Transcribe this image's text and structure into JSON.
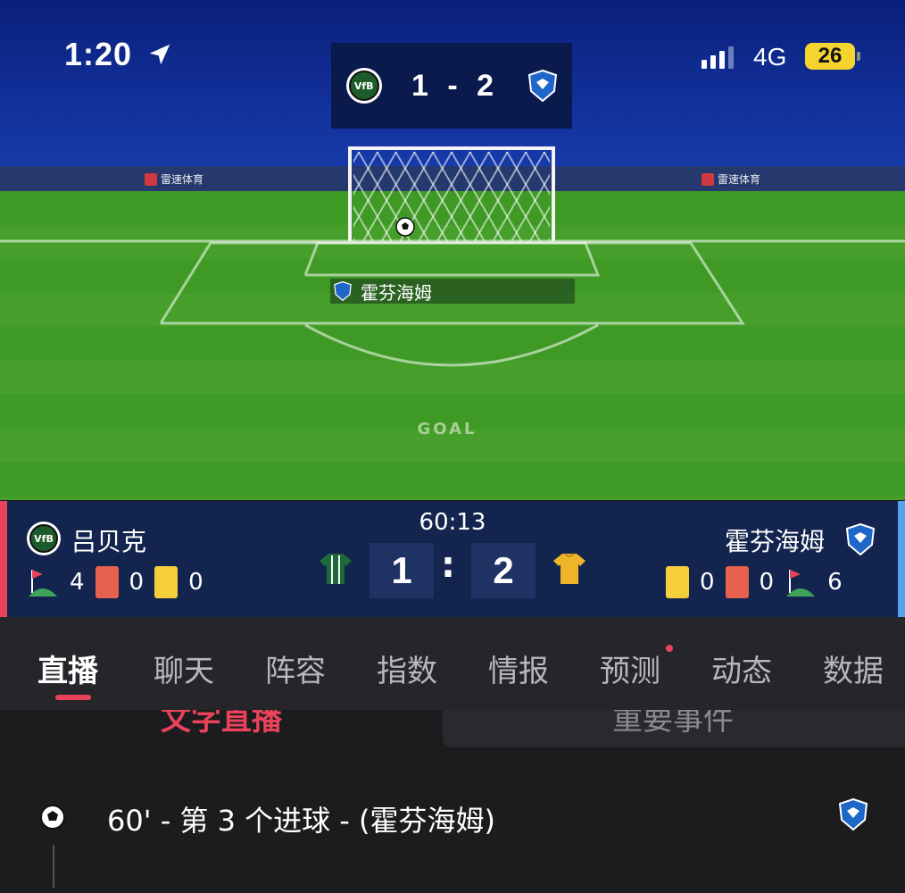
{
  "status_bar": {
    "time": "1:20",
    "network": "4G",
    "battery": "26"
  },
  "scoreboard_top": {
    "score": "1 - 2"
  },
  "pitch": {
    "ad_board_left": "雷速体育",
    "ad_board_right": "雷速体育",
    "scorer_team": "霍芬海姆",
    "event_label": "GOAL"
  },
  "match_bar": {
    "clock": "60:13",
    "home": {
      "name": "吕贝克",
      "corners": "4",
      "red_cards": "0",
      "yellow_cards": "0",
      "score": "1",
      "badge_text": "VfB"
    },
    "away": {
      "name": "霍芬海姆",
      "corners": "6",
      "red_cards": "0",
      "yellow_cards": "0",
      "score": "2"
    },
    "colon": ":"
  },
  "tabs": [
    {
      "label": "直播",
      "active": true
    },
    {
      "label": "聊天"
    },
    {
      "label": "阵容"
    },
    {
      "label": "指数"
    },
    {
      "label": "情报"
    },
    {
      "label": "预测"
    },
    {
      "label": "动态"
    },
    {
      "label": "数据"
    }
  ],
  "subtabs": {
    "left": "文字直播",
    "right": "重要事件"
  },
  "events": [
    {
      "text": "60' - 第 3 个进球 - (霍芬海姆)"
    }
  ],
  "colors": {
    "accent_red": "#e8435a",
    "home_kit": "#1e6b3a",
    "away_kit": "#f0b429",
    "away_blue": "#1e66c8"
  }
}
